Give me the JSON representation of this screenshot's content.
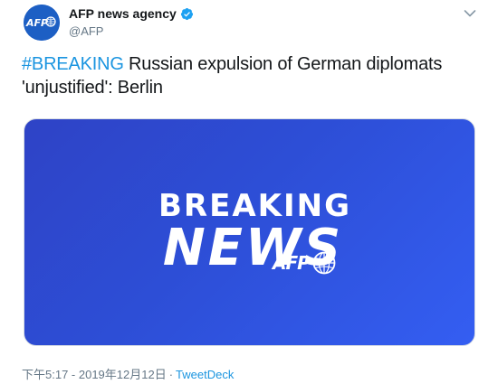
{
  "tweet": {
    "author": {
      "display_name": "AFP news agency",
      "handle": "@AFP",
      "avatar_label": "AFP"
    },
    "text": {
      "hashtag": "#BREAKING",
      "body": " Russian expulsion of German diplomats 'unjustified': Berlin"
    },
    "media": {
      "line1": "BREAKING",
      "line2": "NEWS",
      "logo": "AFP"
    },
    "footer": {
      "timestamp": "下午5:17 - 2019年12月12日",
      "separator": "·",
      "source": "TweetDeck"
    }
  },
  "colors": {
    "link": "#1b95e0",
    "verified": "#1da1f2",
    "card_gradient_start": "#2e43c6",
    "card_gradient_end": "#345ef2",
    "muted_text": "#657786"
  },
  "icons": {
    "verified": "verified-badge-icon",
    "caret": "chevron-down-icon",
    "logo_globe": "globe-icon"
  }
}
